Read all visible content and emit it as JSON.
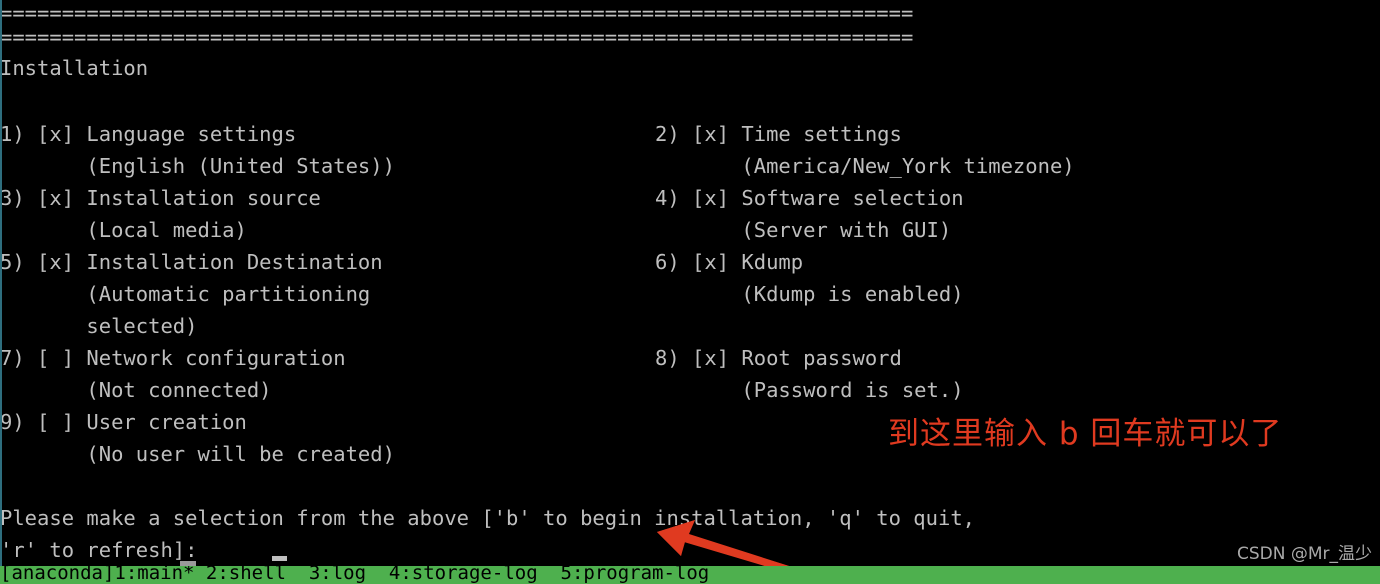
{
  "terminal": {
    "rule_top": "==========================================================================",
    "rule_second": "==========================================================================",
    "screen_title": "Installation",
    "menu_items": [
      {
        "number": "1)",
        "checkbox": "[x]",
        "label": "Language settings",
        "detail": "(English (United States))",
        "line": "1) [x] Language settings",
        "detail_line": "       (English (United States))"
      },
      {
        "number": "2)",
        "checkbox": "[x]",
        "label": "Time settings",
        "detail": "(America/New_York timezone)",
        "line": "2) [x] Time settings",
        "detail_line": "       (America/New_York timezone)"
      },
      {
        "number": "3)",
        "checkbox": "[x]",
        "label": "Installation source",
        "detail": "(Local media)",
        "line": "3) [x] Installation source",
        "detail_line": "       (Local media)"
      },
      {
        "number": "4)",
        "checkbox": "[x]",
        "label": "Software selection",
        "detail": "(Server with GUI)",
        "line": "4) [x] Software selection",
        "detail_line": "       (Server with GUI)"
      },
      {
        "number": "5)",
        "checkbox": "[x]",
        "label": "Installation Destination",
        "detail": "(Automatic partitioning selected)",
        "line": "5) [x] Installation Destination",
        "detail_line": "       (Automatic partitioning",
        "detail_line2": "       selected)"
      },
      {
        "number": "6)",
        "checkbox": "[x]",
        "label": "Kdump",
        "detail": "(Kdump is enabled)",
        "line": "6) [x] Kdump",
        "detail_line": "       (Kdump is enabled)"
      },
      {
        "number": "7)",
        "checkbox": "[ ]",
        "label": "Network configuration",
        "detail": "(Not connected)",
        "line": "7) [ ] Network configuration",
        "detail_line": "       (Not connected)"
      },
      {
        "number": "8)",
        "checkbox": "[x]",
        "label": "Root password",
        "detail": "(Password is set.)",
        "line": "8) [x] Root password",
        "detail_line": "       (Password is set.)"
      },
      {
        "number": "9)",
        "checkbox": "[ ]",
        "label": "User creation",
        "detail": "(No user will be created)",
        "line": "9) [ ] User creation",
        "detail_line": "       (No user will be created)"
      }
    ],
    "prompt_line1": "Please make a selection from the above ['b' to begin installation, 'q' to quit,",
    "prompt_line2": "'r' to refresh]:",
    "cursor": "_"
  },
  "statusbar": {
    "text": "[anaconda]1:main* 2:shell  3:log  4:storage-log  5:program-log",
    "windows": [
      "[anaconda]",
      "1:main*",
      "2:shell",
      "3:log",
      "4:storage-log",
      "5:program-log"
    ],
    "bg_color": "#4eb04e",
    "fg_color": "#000000"
  },
  "annotation": {
    "text": "到这里输入 b 回车就可以了",
    "color": "#e03a20",
    "arrow": {
      "name": "red-arrow",
      "color": "#e03a20",
      "direction": "up-left"
    }
  },
  "watermark": {
    "text": "CSDN @Mr_温少"
  },
  "colors": {
    "background": "#000000",
    "foreground": "#bfbfbf",
    "accent_red": "#e03a20",
    "status_green": "#4eb04e",
    "edge_teal": "#2e6e7e"
  }
}
